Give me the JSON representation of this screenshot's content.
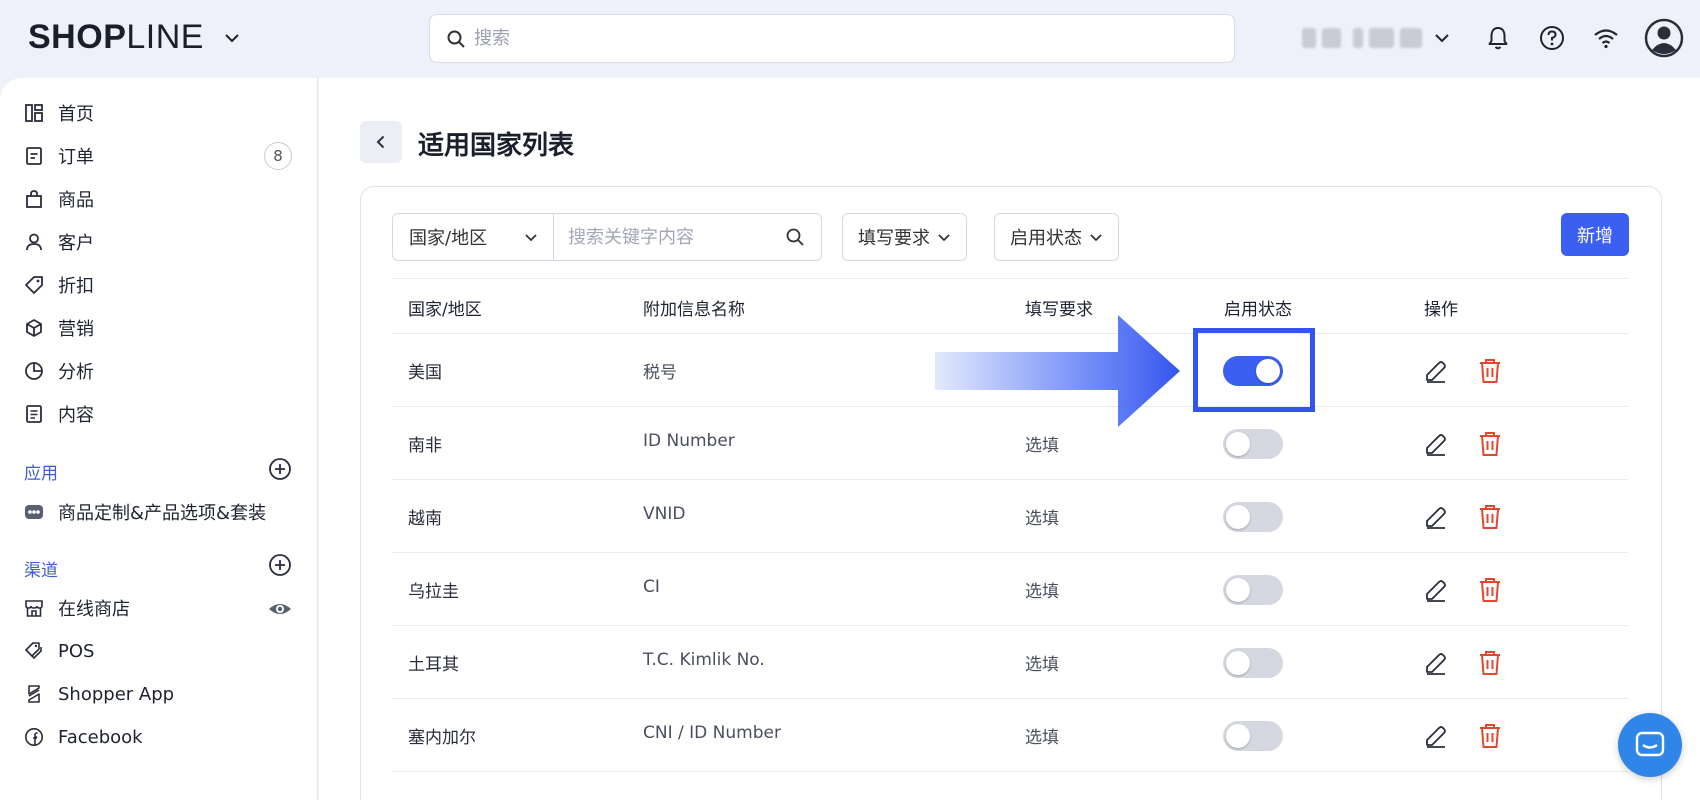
{
  "header": {
    "logo_bold": "SH",
    "logo_o": "O",
    "logo_bold2": "P",
    "logo_thin": "LINE",
    "search_placeholder": "搜索"
  },
  "sidebar": {
    "items": [
      {
        "label": "首页",
        "icon": "home-icon"
      },
      {
        "label": "订单",
        "icon": "order-icon",
        "badge": "8"
      },
      {
        "label": "商品",
        "icon": "bag-icon"
      },
      {
        "label": "客户",
        "icon": "user-icon"
      },
      {
        "label": "折扣",
        "icon": "tag-icon"
      },
      {
        "label": "营销",
        "icon": "cube-icon"
      },
      {
        "label": "分析",
        "icon": "pie-chart-icon"
      },
      {
        "label": "内容",
        "icon": "document-icon"
      }
    ],
    "apps_label": "应用",
    "apps": [
      {
        "label": "商品定制&产品选项&套装",
        "icon": "app-badge-icon"
      }
    ],
    "channels_label": "渠道",
    "channels": [
      {
        "label": "在线商店",
        "icon": "store-icon"
      },
      {
        "label": "POS",
        "icon": "pos-tag-icon"
      },
      {
        "label": "Shopper App",
        "icon": "shopper-app-icon"
      },
      {
        "label": "Facebook",
        "icon": "facebook-icon"
      }
    ]
  },
  "page": {
    "title": "适用国家列表"
  },
  "filters": {
    "region_select": "国家/地区",
    "keyword_placeholder": "搜索关键字内容",
    "requirement_dropdown": "填写要求",
    "status_dropdown": "启用状态",
    "add_button": "新增"
  },
  "table": {
    "headers": [
      "国家/地区",
      "附加信息名称",
      "填写要求",
      "启用状态",
      "操作"
    ],
    "rows": [
      {
        "country": "美国",
        "info": "税号",
        "requirement": "",
        "enabled": true
      },
      {
        "country": "南非",
        "info": "ID Number",
        "requirement": "选填",
        "enabled": false
      },
      {
        "country": "越南",
        "info": "VNID",
        "requirement": "选填",
        "enabled": false
      },
      {
        "country": "乌拉圭",
        "info": "CI",
        "requirement": "选填",
        "enabled": false
      },
      {
        "country": "土耳其",
        "info": "T.C. Kimlik No.",
        "requirement": "选填",
        "enabled": false
      },
      {
        "country": "塞内加尔",
        "info": "CNI / ID Number",
        "requirement": "选填",
        "enabled": false
      }
    ]
  },
  "colors": {
    "accent": "#3b5ff0",
    "delete": "#e0492f",
    "highlight": "#3355ee",
    "chat": "#2f86e8"
  }
}
